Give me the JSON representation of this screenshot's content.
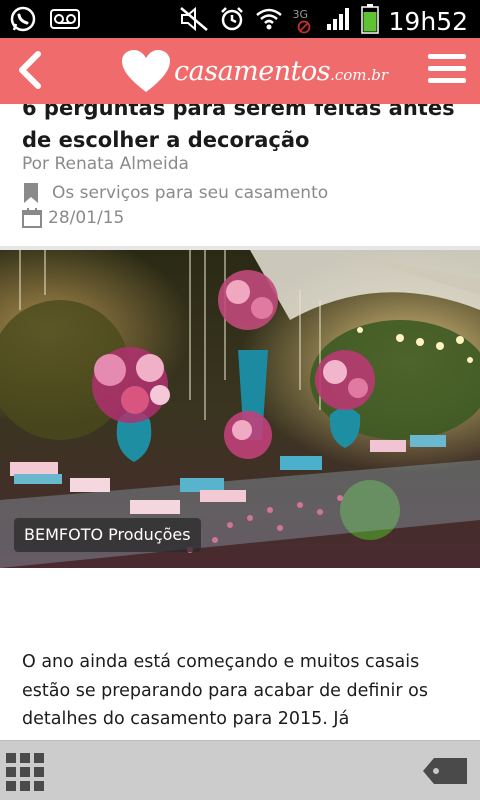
{
  "status_bar": {
    "time": "19h52",
    "network": "3G",
    "icons": [
      "whatsapp-icon",
      "voicemail-icon",
      "mute-icon",
      "alarm-icon",
      "wifi-icon",
      "signal-icon",
      "battery-icon"
    ]
  },
  "nav": {
    "brand_name": "casamentos",
    "brand_suffix": ".com.br"
  },
  "article": {
    "title": "6 perguntas para serem feitas antes de escolher a decoração",
    "author": "Por Renata Almeida",
    "category": "Os serviços para seu casamento",
    "date": "28/01/15",
    "photo_credit": "BEMFOTO Produções",
    "body": "O ano ainda está começando e muitos casais estão se preparando para acabar de definir os detalhes do casamento para 2015. Já"
  },
  "colors": {
    "brand": "#f06b6b",
    "meta_text": "#8a8a8a"
  }
}
